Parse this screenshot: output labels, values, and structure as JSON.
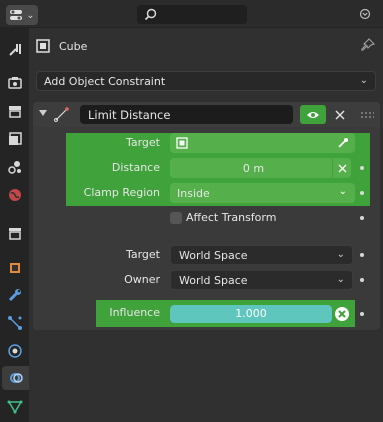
{
  "header": {
    "editor_icon": "properties-editor-icon",
    "search_placeholder": "",
    "menu_icon": "dots-menu-icon"
  },
  "sidebar": {
    "tabs": [
      {
        "icon": "tool-icon",
        "active": false
      },
      {
        "icon": "render-icon",
        "active": false
      },
      {
        "icon": "output-icon",
        "active": false
      },
      {
        "icon": "view-layer-icon",
        "active": false
      },
      {
        "icon": "scene-icon",
        "active": false
      },
      {
        "icon": "world-icon",
        "active": false
      },
      {
        "icon": "collection-icon",
        "active": false
      },
      {
        "icon": "object-icon",
        "active": false
      },
      {
        "icon": "modifier-wrench-icon",
        "active": false
      },
      {
        "icon": "particles-icon",
        "active": false
      },
      {
        "icon": "physics-icon",
        "active": false
      },
      {
        "icon": "constraint-icon",
        "active": true
      },
      {
        "icon": "object-data-mesh-icon",
        "active": false
      }
    ]
  },
  "object": {
    "name": "Cube"
  },
  "add_constraint": {
    "label": "Add Object Constraint"
  },
  "constraint": {
    "name": "Limit Distance",
    "fields": {
      "target_label": "Target",
      "distance_label": "Distance",
      "distance_value": "0 m",
      "clamp_label": "Clamp Region",
      "clamp_value": "Inside",
      "affect_transform_label": "Affect Transform",
      "affect_transform_checked": false,
      "target_space_label": "Target",
      "target_space_value": "World Space",
      "owner_space_label": "Owner",
      "owner_space_value": "World Space",
      "influence_label": "Influence",
      "influence_value": "1.000",
      "influence_fraction": 1.0
    }
  },
  "colors": {
    "accent_green": "#3fa23a",
    "field_green": "#55b04b",
    "influence_teal": "#5fc6bd",
    "background": "#303030"
  }
}
